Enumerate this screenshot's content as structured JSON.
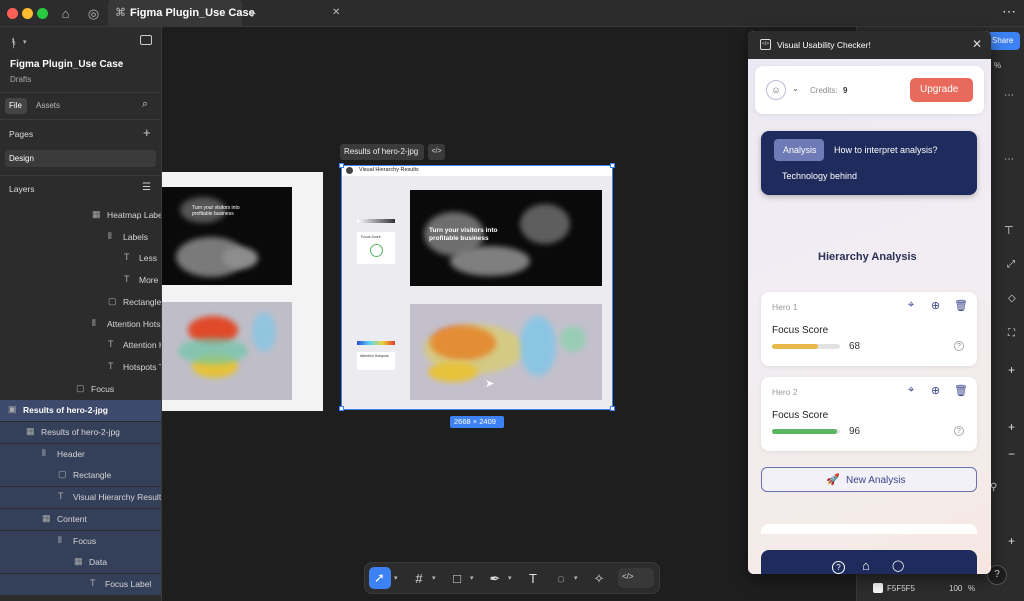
{
  "tabbar": {
    "file_tab_title": "Figma Plugin_Use Case",
    "close_glyph": "✕",
    "new_tab_glyph": "+"
  },
  "file": {
    "name": "Figma Plugin_Use Case",
    "location": "Drafts",
    "tabs": [
      "File",
      "Assets"
    ]
  },
  "pages": {
    "heading": "Pages",
    "items": [
      "Design"
    ]
  },
  "layers": {
    "heading": "Layers",
    "items": [
      {
        "label": "Heatmap Label",
        "icon": "▦"
      },
      {
        "label": "Labels",
        "icon": "⫴"
      },
      {
        "label": "Less",
        "icon": "T"
      },
      {
        "label": "More",
        "icon": "T"
      },
      {
        "label": "Rectangle",
        "icon": "▢"
      },
      {
        "label": "Attention Hotsp",
        "icon": "⫴"
      },
      {
        "label": "Attention H",
        "icon": "T"
      },
      {
        "label": "Hotspots T",
        "icon": "T"
      },
      {
        "label": "Focus",
        "icon": "▢"
      },
      {
        "label": "Results of hero-2-jpg",
        "icon": "▣"
      },
      {
        "label": "Results of hero-2-jpg",
        "icon": "▦"
      },
      {
        "label": "Header",
        "icon": "⫴"
      },
      {
        "label": "Rectangle",
        "icon": "▢"
      },
      {
        "label": "Visual Hierarchy Results",
        "icon": "T"
      },
      {
        "label": "Content",
        "icon": "▦"
      },
      {
        "label": "Focus",
        "icon": "⫴"
      },
      {
        "label": "Data",
        "icon": "▦"
      },
      {
        "label": "Focus Label",
        "icon": "T"
      }
    ]
  },
  "canvas": {
    "frame_label": "Results of hero-2-jpg",
    "frame_header": "Visual Hierarchy Results",
    "dimension_badge": "2668 × 2409",
    "hero_line1": "Turn your visitors into",
    "hero_line2": "profitable business",
    "focus_score_label": "Focus Score",
    "attention_label": "Attention Hotspots"
  },
  "plugin": {
    "title": "Visual Usability Checker!",
    "credits_label": "Credits:",
    "credits_value": "9",
    "upgrade_label": "Upgrade",
    "tabs": [
      "Analysis",
      "How to interpret analysis?",
      "Technology behind"
    ],
    "section_title": "Hierarchy Analysis",
    "results": [
      {
        "name": "Hero 1",
        "metric": "Focus Score",
        "score": "68",
        "fill": 0.68,
        "color": "#e8b84a"
      },
      {
        "name": "Hero 2",
        "metric": "Focus Score",
        "score": "96",
        "fill": 0.96,
        "color": "#5bb462"
      }
    ],
    "new_analysis_label": "New Analysis"
  },
  "right_panel": {
    "share_label": "Share",
    "percent": "%",
    "fill_hex": "F5F5F5",
    "fill_opacity": "100",
    "fill_pct": "%"
  },
  "help_glyph": "?"
}
